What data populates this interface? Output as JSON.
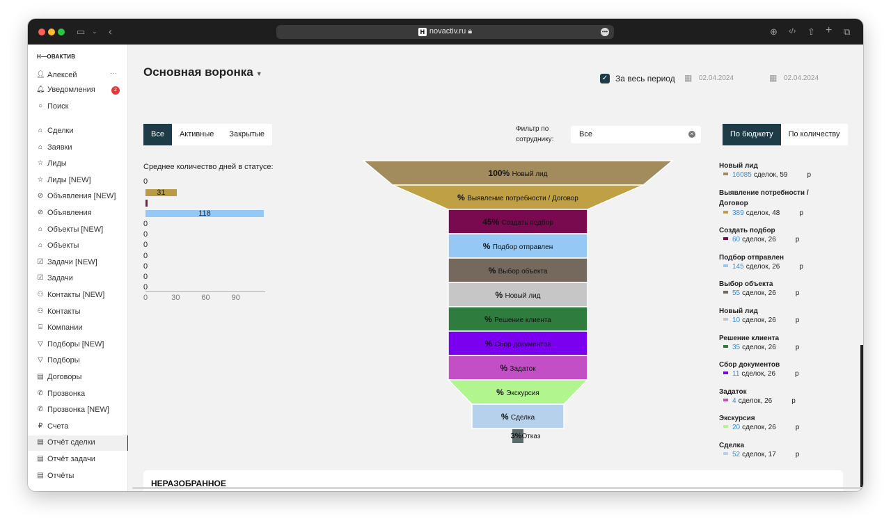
{
  "browser": {
    "url": "novactiv.ru",
    "favicon": "H",
    "icons": [
      "sidebar-icon",
      "chevron-down-icon",
      "back-icon",
      "lock-icon",
      "more-icon",
      "download-icon",
      "code-icon",
      "share-icon",
      "plus-icon",
      "tabs-icon"
    ]
  },
  "sidebar": {
    "logo": "Н—ОВАКТИВ",
    "user": "Алексей",
    "user_menu": "···",
    "notifications": "Уведомления",
    "notifications_count": "2",
    "search": "Поиск",
    "items": [
      {
        "label": "Сделки",
        "icon": "bag-icon"
      },
      {
        "label": "Заявки",
        "icon": "bag-icon"
      },
      {
        "label": "Лиды",
        "icon": "star-icon"
      },
      {
        "label": "Лиды [NEW]",
        "icon": "star-icon"
      },
      {
        "label": "Объявления [NEW]",
        "icon": "compass-icon"
      },
      {
        "label": "Объявления",
        "icon": "compass-icon"
      },
      {
        "label": "Объекты [NEW]",
        "icon": "home-icon"
      },
      {
        "label": "Объекты",
        "icon": "home-icon"
      },
      {
        "label": "Задачи [NEW]",
        "icon": "checkbox-icon"
      },
      {
        "label": "Задачи",
        "icon": "checkbox-icon"
      },
      {
        "label": "Контакты [NEW]",
        "icon": "people-icon"
      },
      {
        "label": "Контакты",
        "icon": "people-icon"
      },
      {
        "label": "Компании",
        "icon": "building-icon"
      },
      {
        "label": "Подборы [NEW]",
        "icon": "filter-icon"
      },
      {
        "label": "Подборы",
        "icon": "filter-icon"
      },
      {
        "label": "Договоры",
        "icon": "document-icon"
      },
      {
        "label": "Прозвонка",
        "icon": "phone-icon"
      },
      {
        "label": "Прозвонка [NEW]",
        "icon": "phone-icon"
      },
      {
        "label": "Счета",
        "icon": "ruble-icon"
      },
      {
        "label": "Отчёт сделки",
        "icon": "report-icon",
        "active": true
      },
      {
        "label": "Отчёт задачи",
        "icon": "report-icon"
      },
      {
        "label": "Отчёты",
        "icon": "report-icon"
      }
    ]
  },
  "header": {
    "title": "Основная воронка",
    "all_period": "За весь период",
    "date_from": "02.04.2024",
    "date_to": "02.04.2024"
  },
  "tabs": [
    "Все",
    "Активные",
    "Закрытые"
  ],
  "active_tab": "Все",
  "filter": {
    "label": "Фильтр по сотруднику:",
    "value": "Все"
  },
  "mode": {
    "budget": "По бюджету",
    "count": "По количеству",
    "active": "По бюджету"
  },
  "days_chart": {
    "title": "Среднее количество дней в статусе:",
    "zero": "0",
    "bars": [
      {
        "value": 0
      },
      {
        "value": 31,
        "color": "#b99a45"
      },
      {
        "value": 1,
        "color": "#7a1a55",
        "label": "1"
      },
      {
        "value": 118,
        "color": "#96c8f5"
      },
      {
        "value": 0
      },
      {
        "value": 0
      },
      {
        "value": 0
      },
      {
        "value": 0
      },
      {
        "value": 0
      },
      {
        "value": 0
      },
      {
        "value": 0
      }
    ],
    "ticks": [
      "0",
      "30",
      "60",
      "90"
    ],
    "max": 118
  },
  "funnel": [
    {
      "pct": "100%",
      "label": "Новый лид",
      "color": "#a28b5c"
    },
    {
      "pct": "%",
      "label": "Выявление потребности / Договор",
      "color": "#bfa045"
    },
    {
      "pct": "45%",
      "label": "Создать подбор",
      "color": "#7a0a50"
    },
    {
      "pct": "%",
      "label": "Подбор отправлен",
      "color": "#96c8f5"
    },
    {
      "pct": "%",
      "label": "Выбор объекта",
      "color": "#75685d"
    },
    {
      "pct": "%",
      "label": "Новый лид",
      "color": "#c6c6c6"
    },
    {
      "pct": "%",
      "label": "Решение клиента",
      "color": "#2e7d3e"
    },
    {
      "pct": "%",
      "label": "Сбор документов",
      "color": "#7b00ef"
    },
    {
      "pct": "%",
      "label": "Задаток",
      "color": "#c24fc6"
    },
    {
      "pct": "%",
      "label": "Экскурсия",
      "color": "#b0f58e"
    },
    {
      "pct": "%",
      "label": "Сделка",
      "color": "#b6d1ec"
    },
    {
      "pct": "3%",
      "label": "Отказ",
      "color": "#5b6b6b"
    }
  ],
  "legend": [
    {
      "title": "Новый лид",
      "num": "16085",
      "text": "сделок, 59",
      "unit": "р",
      "color": "#a28b5c"
    },
    {
      "title": "Выявление потребности / Договор",
      "num": "389",
      "text": "сделок, 48",
      "unit": "р",
      "color": "#bfa045"
    },
    {
      "title": "Создать подбор",
      "num": "60",
      "text": "сделок, 26",
      "unit": "р",
      "color": "#7a0a50"
    },
    {
      "title": "Подбор отправлен",
      "num": "145",
      "text": "сделок, 26",
      "unit": "р",
      "color": "#96c8f5"
    },
    {
      "title": "Выбор объекта",
      "num": "55",
      "text": "сделок, 26",
      "unit": "р",
      "color": "#75685d"
    },
    {
      "title": "Новый лид",
      "num": "10",
      "text": "сделок, 26",
      "unit": "р",
      "color": "#c6c6c6"
    },
    {
      "title": "Решение клиента",
      "num": "35",
      "text": "сделок, 26",
      "unit": "р",
      "color": "#2e7d3e"
    },
    {
      "title": "Сбор документов",
      "num": "11",
      "text": "сделок, 26",
      "unit": "р",
      "color": "#7b00ef"
    },
    {
      "title": "Задаток",
      "num": "4",
      "text": "сделок, 26",
      "unit": "р",
      "color": "#c24fc6"
    },
    {
      "title": "Экскурсия",
      "num": "20",
      "text": "сделок, 26",
      "unit": "р",
      "color": "#b0f58e"
    },
    {
      "title": "Сделка",
      "num": "52",
      "text": "сделок, 17",
      "unit": "р",
      "color": "#b6d1ec"
    }
  ],
  "section": {
    "title": "НЕРАЗОБРАННОЕ"
  }
}
